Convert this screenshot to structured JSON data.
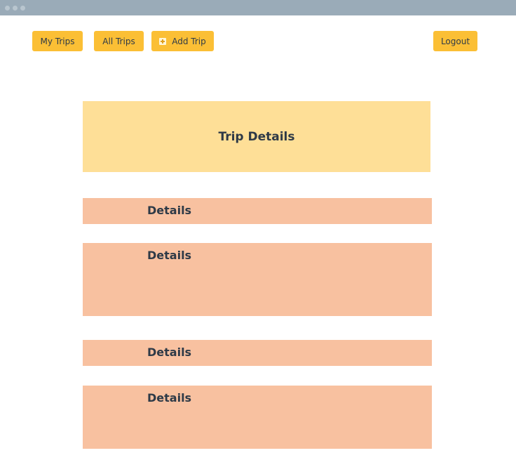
{
  "nav": {
    "my_trips": "My Trips",
    "all_trips": "All Trips",
    "add_trip": "Add Trip",
    "logout": "Logout"
  },
  "header": {
    "title": "Trip Details"
  },
  "sections": [
    {
      "title": "Details"
    },
    {
      "title": "Details"
    },
    {
      "title": "Details"
    },
    {
      "title": "Details"
    }
  ],
  "colors": {
    "titlebar": "#9aabb8",
    "button": "#fbbf35",
    "header_box": "#fedf97",
    "section": "#f8c1a0",
    "text": "#2e3a47"
  },
  "icons": {
    "add_trip": "plus-icon"
  }
}
